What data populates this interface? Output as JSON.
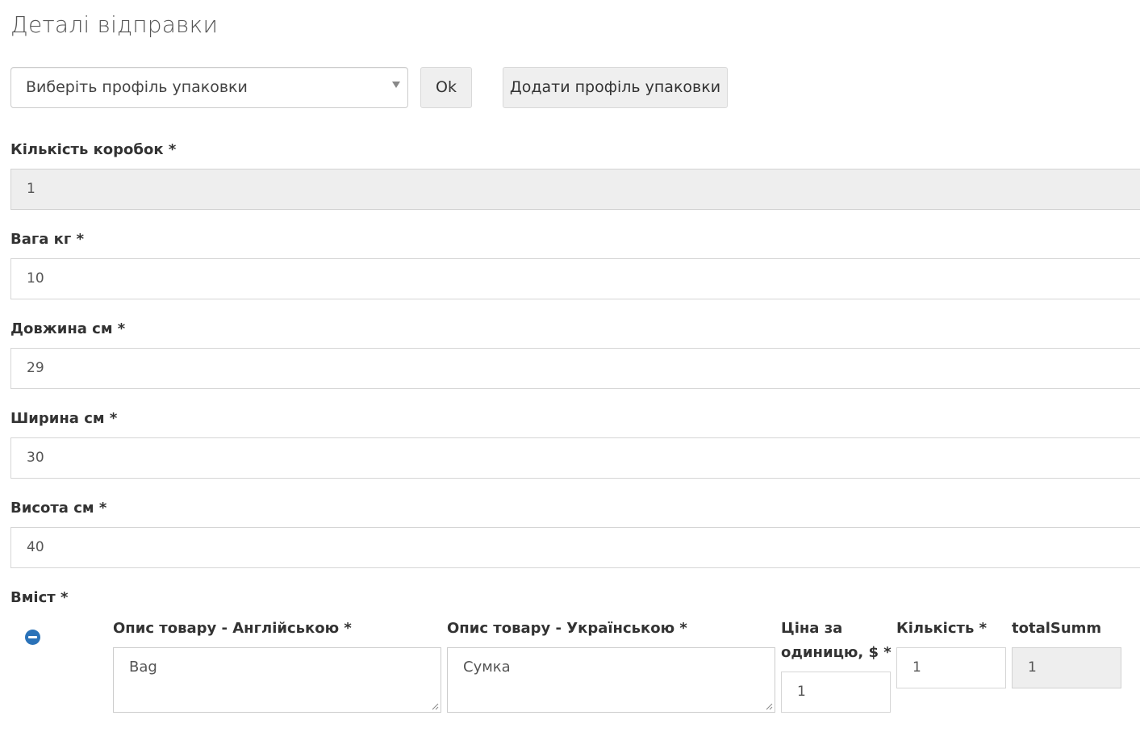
{
  "page": {
    "title": "Деталі відправки"
  },
  "packaging": {
    "select_value": "Виберіть профіль упаковки",
    "ok_label": "Ok",
    "add_profile_label": "Додати профіль упаковки"
  },
  "fields": {
    "boxes": {
      "label": "Кількість коробок *",
      "value": "1"
    },
    "weight": {
      "label": "Вага кг *",
      "value": "10"
    },
    "length": {
      "label": "Довжина см *",
      "value": "29"
    },
    "width": {
      "label": "Ширина см *",
      "value": "30"
    },
    "height": {
      "label": "Висота см *",
      "value": "40"
    }
  },
  "contents": {
    "label": "Вміст *",
    "columns": {
      "desc_en": "Опис товару - Англійською *",
      "desc_uk": "Опис товару - Українською *",
      "unit_price": "Ціна за одиницю, $ *",
      "quantity": "Кількість *",
      "total": "totalSumm"
    },
    "rows": [
      {
        "desc_en": "Bag",
        "desc_uk": "Сумка",
        "unit_price": "1",
        "quantity": "1",
        "total": "1"
      }
    ]
  },
  "colors": {
    "remove_icon": "#2a72b8",
    "readonly_bg": "#eeeeee"
  }
}
